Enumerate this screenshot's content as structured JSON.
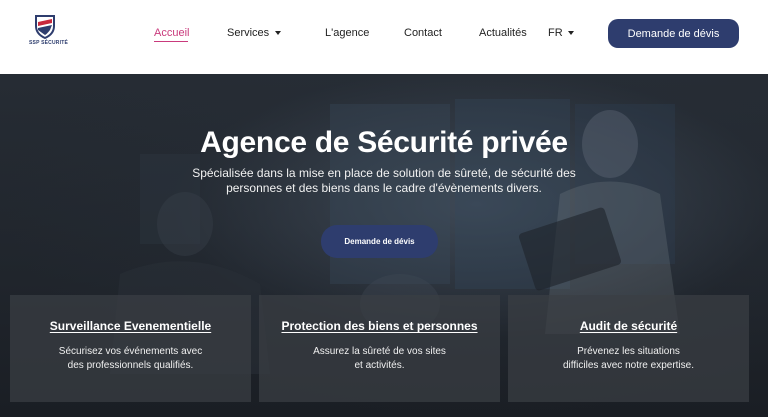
{
  "header": {
    "logo_text": "SSP SÉCURITÉ",
    "nav": [
      {
        "label": "Accueil"
      },
      {
        "label": "Services"
      },
      {
        "label": "L'agence"
      },
      {
        "label": "Contact"
      },
      {
        "label": "Actualités"
      },
      {
        "label": "FR"
      }
    ],
    "cta_label": "Demande de dévis"
  },
  "hero": {
    "title": "Agence de Sécurité privée",
    "subtitle_line1": "Spécialisée dans la mise en place de solution de sûreté, de sécurité des",
    "subtitle_line2": "personnes et des biens dans le cadre d'évènements divers.",
    "cta_label": "Demande de dévis"
  },
  "cards": [
    {
      "title": "Surveillance Evenementielle",
      "line1": "Sécurisez vos événements avec",
      "line2": "des professionnels qualifiés."
    },
    {
      "title": "Protection des biens et personnes",
      "line1": "Assurez la sûreté de vos sites",
      "line2": "et activités."
    },
    {
      "title": "Audit de sécurité",
      "line1": "Prévenez les situations",
      "line2": "difficiles avec notre expertise."
    }
  ],
  "colors": {
    "brand_navy": "#2e3d6e",
    "active_nav": "#c93a7c",
    "logo_red": "#c8283c"
  }
}
